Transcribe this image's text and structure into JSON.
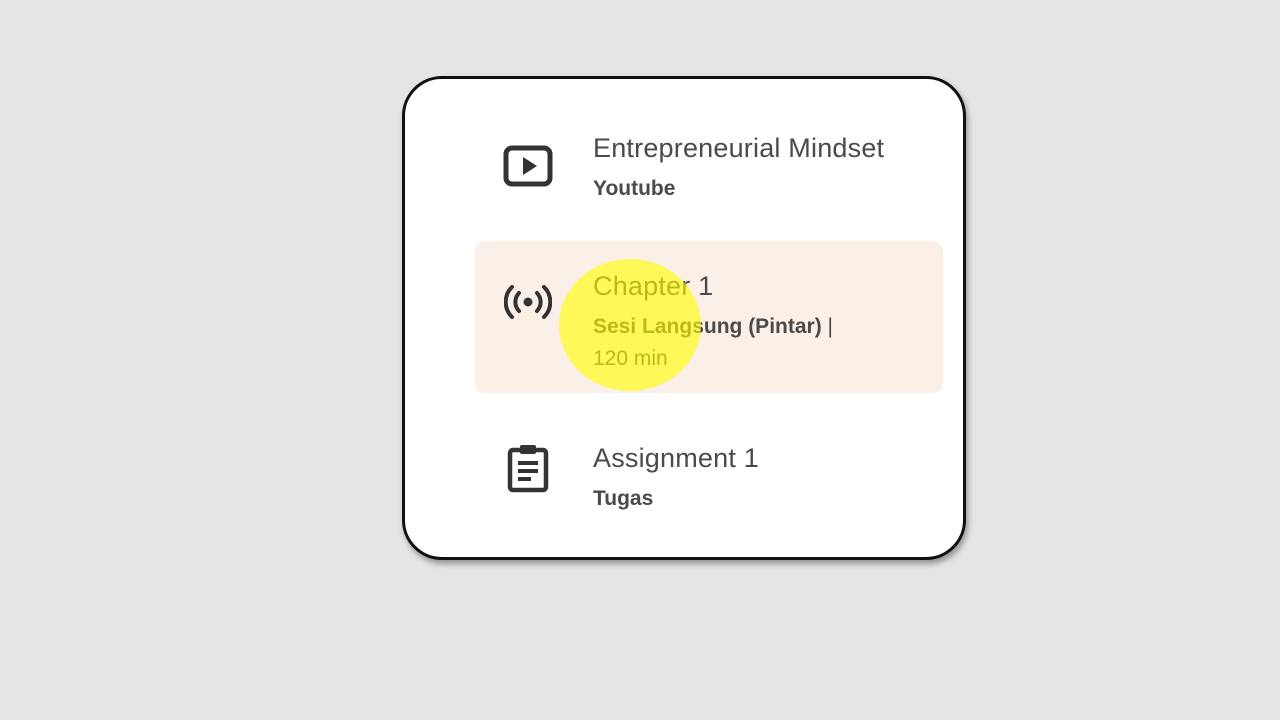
{
  "lesson_list": {
    "items": [
      {
        "icon": "play-video-icon",
        "title": "Entrepreneurial Mindset",
        "subtitle": "Youtube",
        "active": false
      },
      {
        "icon": "live-broadcast-icon",
        "title": "Chapter 1",
        "subtitle": "Sesi Langsung (Pintar)",
        "separator": "|",
        "meta": "120 min",
        "active": true
      },
      {
        "icon": "clipboard-icon",
        "title": "Assignment 1",
        "subtitle": "Tugas",
        "active": false
      }
    ]
  },
  "colors": {
    "background": "#e5e5e5",
    "card": "#ffffff",
    "active_item": "#fbf0e8",
    "text": "#4a4a4a",
    "cursor_highlight": "#ffff00"
  }
}
